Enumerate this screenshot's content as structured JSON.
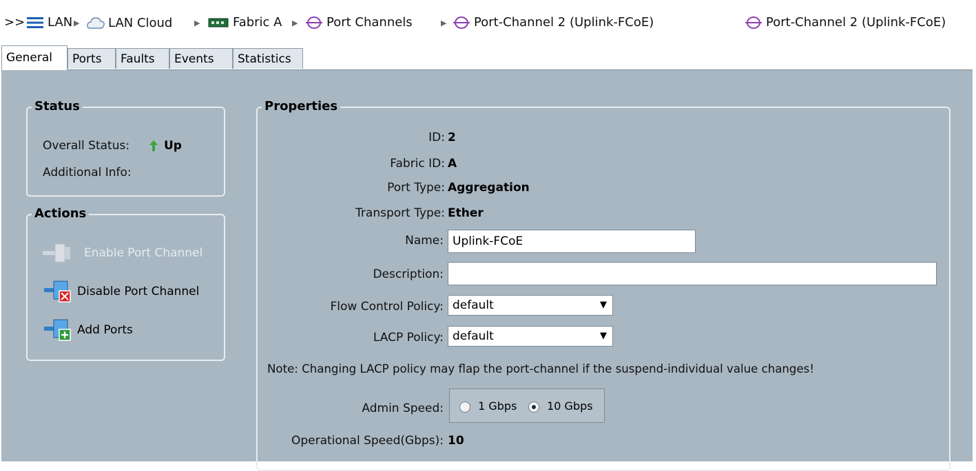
{
  "breadcrumb": {
    "prefix": ">>",
    "items": [
      "LAN",
      "LAN Cloud",
      "Fabric A",
      "Port Channels",
      "Port-Channel 2 (Uplink-FCoE)"
    ],
    "current_title": "Port-Channel 2 (Uplink-FCoE)"
  },
  "tabs": [
    "General",
    "Ports",
    "Faults",
    "Events",
    "Statistics"
  ],
  "status": {
    "title": "Status",
    "overall_label": "Overall Status:",
    "overall_value": "Up",
    "additional_label": "Additional Info:"
  },
  "actions": {
    "title": "Actions",
    "enable": "Enable Port Channel",
    "disable": "Disable Port Channel",
    "add": "Add Ports"
  },
  "properties": {
    "title": "Properties",
    "id_label": "ID:",
    "id_value": "2",
    "fabric_label": "Fabric ID:",
    "fabric_value": "A",
    "port_type_label": "Port Type:",
    "port_type_value": "Aggregation",
    "transport_label": "Transport Type:",
    "transport_value": "Ether",
    "name_label": "Name:",
    "name_value": "Uplink-FCoE",
    "description_label": "Description:",
    "description_value": "",
    "flow_label": "Flow Control Policy:",
    "flow_value": "default",
    "lacp_label": "LACP Policy:",
    "lacp_value": "default",
    "note": "Note: Changing LACP policy may flap the port-channel if the suspend-individual value changes!",
    "admin_speed_label": "Admin Speed:",
    "speed_options": [
      "1 Gbps",
      "10 Gbps"
    ],
    "speed_selected": "10 Gbps",
    "op_speed_label": "Operational Speed(Gbps):",
    "op_speed_value": "10"
  },
  "colors": {
    "panel": "#a9b7c2",
    "accent_purple": "#8b3fb0",
    "status_green": "#3aa53a"
  }
}
